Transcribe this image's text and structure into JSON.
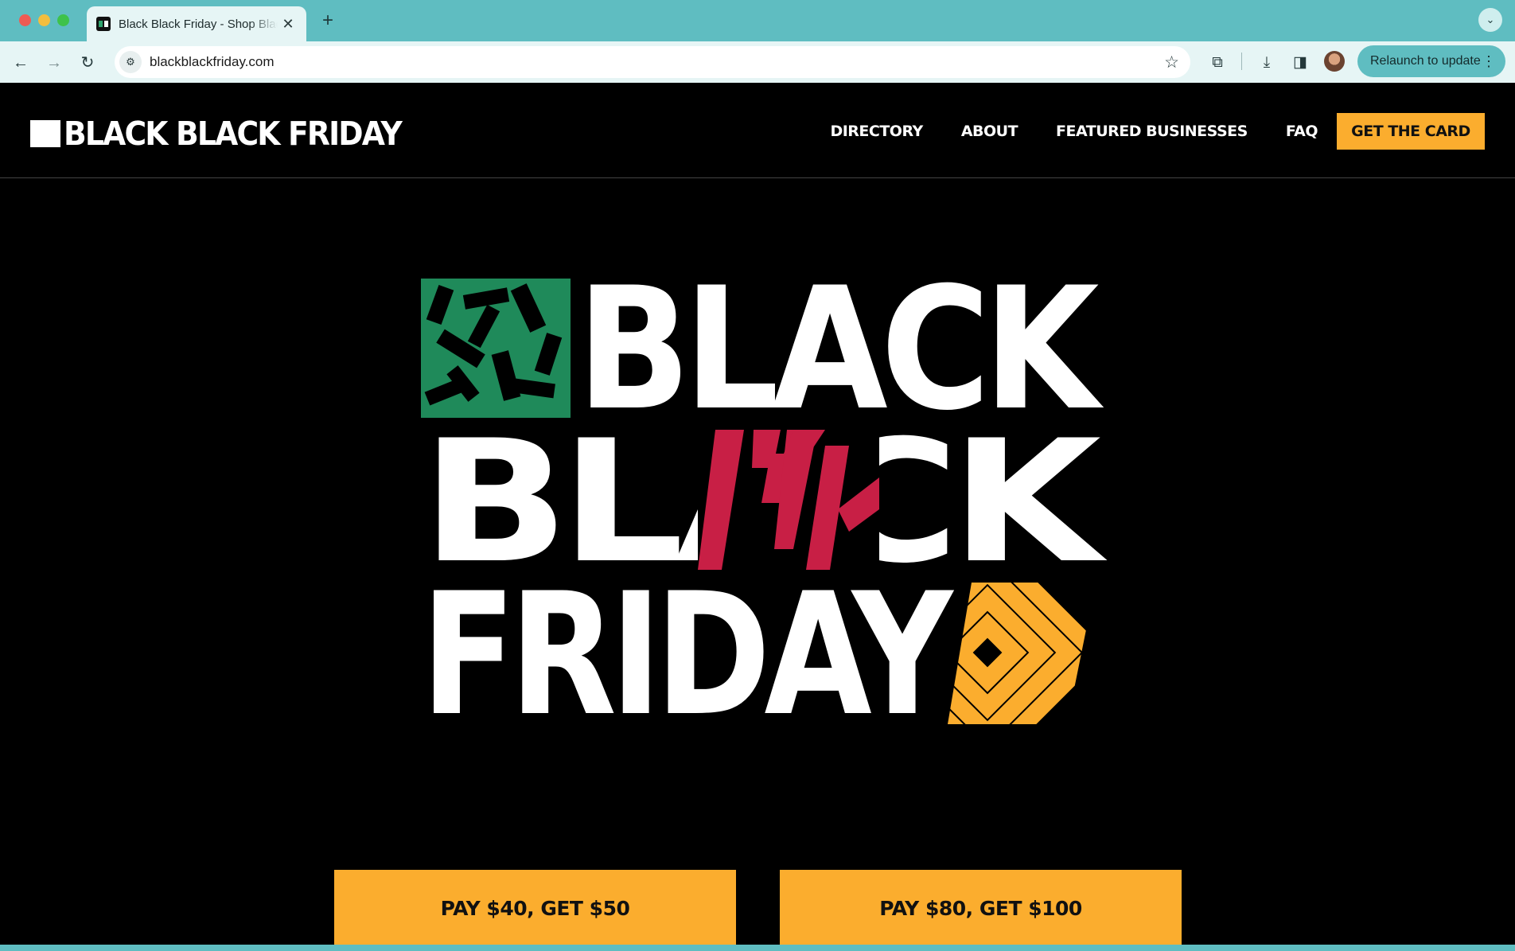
{
  "browser": {
    "tab_title": "Black Black Friday - Shop Black",
    "url": "blackblackfriday.com",
    "relaunch_label": "Relaunch to update",
    "icons": [
      "close-icon",
      "plus-icon",
      "chevron-down-icon",
      "back-arrow-icon",
      "forward-arrow-icon",
      "reload-icon",
      "site-info-icon",
      "star-icon",
      "extensions-icon",
      "download-icon",
      "sidepanel-icon",
      "avatar",
      "more-vertical-icon"
    ]
  },
  "site": {
    "logo_text": "BLACK BLACK FRIDAY",
    "nav": [
      "DIRECTORY",
      "ABOUT",
      "FEATURED BUSINESSES",
      "FAQ"
    ],
    "cta_label": "GET THE CARD",
    "accent_color": "#fbad2e",
    "pattern_colors": {
      "green": "#1f8a5a",
      "red": "#c81f45",
      "orange": "#fbad2e"
    }
  },
  "hero": {
    "wordmark_lines": [
      "BLACK",
      "BLACK",
      "FRIDAY"
    ]
  },
  "offers": [
    {
      "label": "PAY $40, GET $50"
    },
    {
      "label": "PAY $80, GET $100"
    }
  ]
}
